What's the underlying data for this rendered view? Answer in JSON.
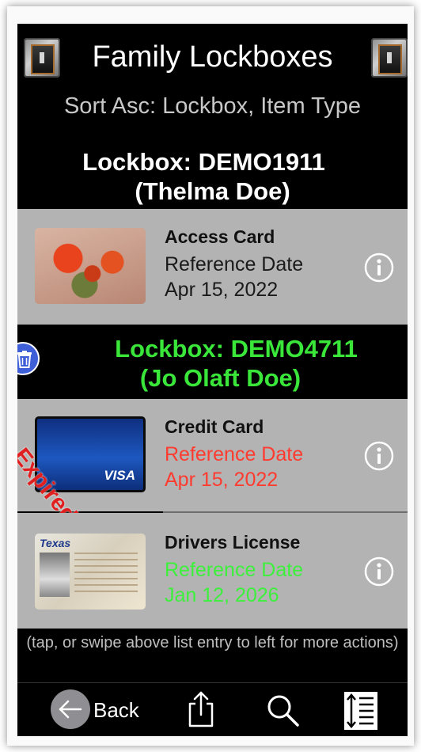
{
  "app": {
    "title": "Family Lockboxes",
    "sort_label": "Sort Asc: Lockbox, Item Type"
  },
  "lockboxes": [
    {
      "line1": "Lockbox: DEMO1911",
      "line2": "(Thelma Doe)",
      "color": "#ffffff",
      "items": [
        {
          "name": "Access Card",
          "label": "Reference Date",
          "date": "Apr 15, 2022",
          "status": "normal",
          "thumbnail": "flower-card-image"
        }
      ]
    },
    {
      "line1": "Lockbox: DEMO4711",
      "line2": "(Jo Olaft Doe)",
      "color": "#39e639",
      "items": [
        {
          "name": "Credit Card",
          "label": "Reference Date",
          "date": "Apr 15, 2022",
          "status": "expired",
          "stamp": "Expired",
          "brand": "VISA",
          "thumbnail": "credit-card-image"
        },
        {
          "name": "Drivers License",
          "label": "Reference Date",
          "date": "Jan 12, 2026",
          "status": "valid",
          "state": "Texas",
          "thumbnail": "drivers-license-image"
        }
      ]
    }
  ],
  "footer": {
    "hint": "(tap, or swipe above list entry to left for more actions)"
  },
  "toolbar": {
    "back_label": "Back",
    "icons": [
      "back-arrow-icon",
      "share-icon",
      "search-icon",
      "sort-icon"
    ]
  },
  "colors": {
    "row_background": "#b3b3b3",
    "expired": "#ff3b30",
    "valid": "#3cf03c",
    "accent_blue": "#3f5fd8"
  }
}
